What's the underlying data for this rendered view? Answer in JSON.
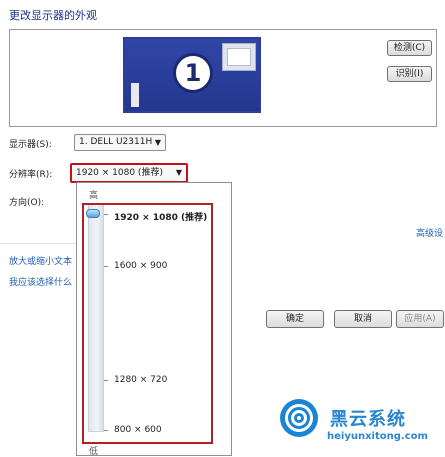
{
  "window": {
    "title": "更改显示器的外观"
  },
  "preview": {
    "monitor_number": "1"
  },
  "buttons": {
    "detect": "检测(C)",
    "identify": "识别(I)",
    "ok": "确定",
    "cancel": "取消",
    "apply": "应用(A)"
  },
  "display": {
    "label": "显示器(S):",
    "value": "1. DELL U2311H"
  },
  "resolution": {
    "label": "分辨率(R):",
    "value": "1920 × 1080 (推荐)",
    "slider_high": "高",
    "slider_low": "低",
    "options": [
      "1920 × 1080 (推荐)",
      "1600 × 900",
      "1280 × 720",
      "800 × 600"
    ],
    "selected_index": 0
  },
  "orientation": {
    "label": "方向(O):"
  },
  "links": {
    "advanced": "高级设",
    "text_size": "放大或缩小文本",
    "help": "我应该选择什么"
  },
  "watermark": {
    "brand": "黑云系统",
    "url": "heiyunxitong.com"
  },
  "colors": {
    "highlight_red": "#c0141c",
    "link_blue": "#1f5fb5",
    "monitor_blue": "#2c3d9c"
  },
  "icons": {
    "dropdown_arrow": "triangle-down-icon"
  }
}
